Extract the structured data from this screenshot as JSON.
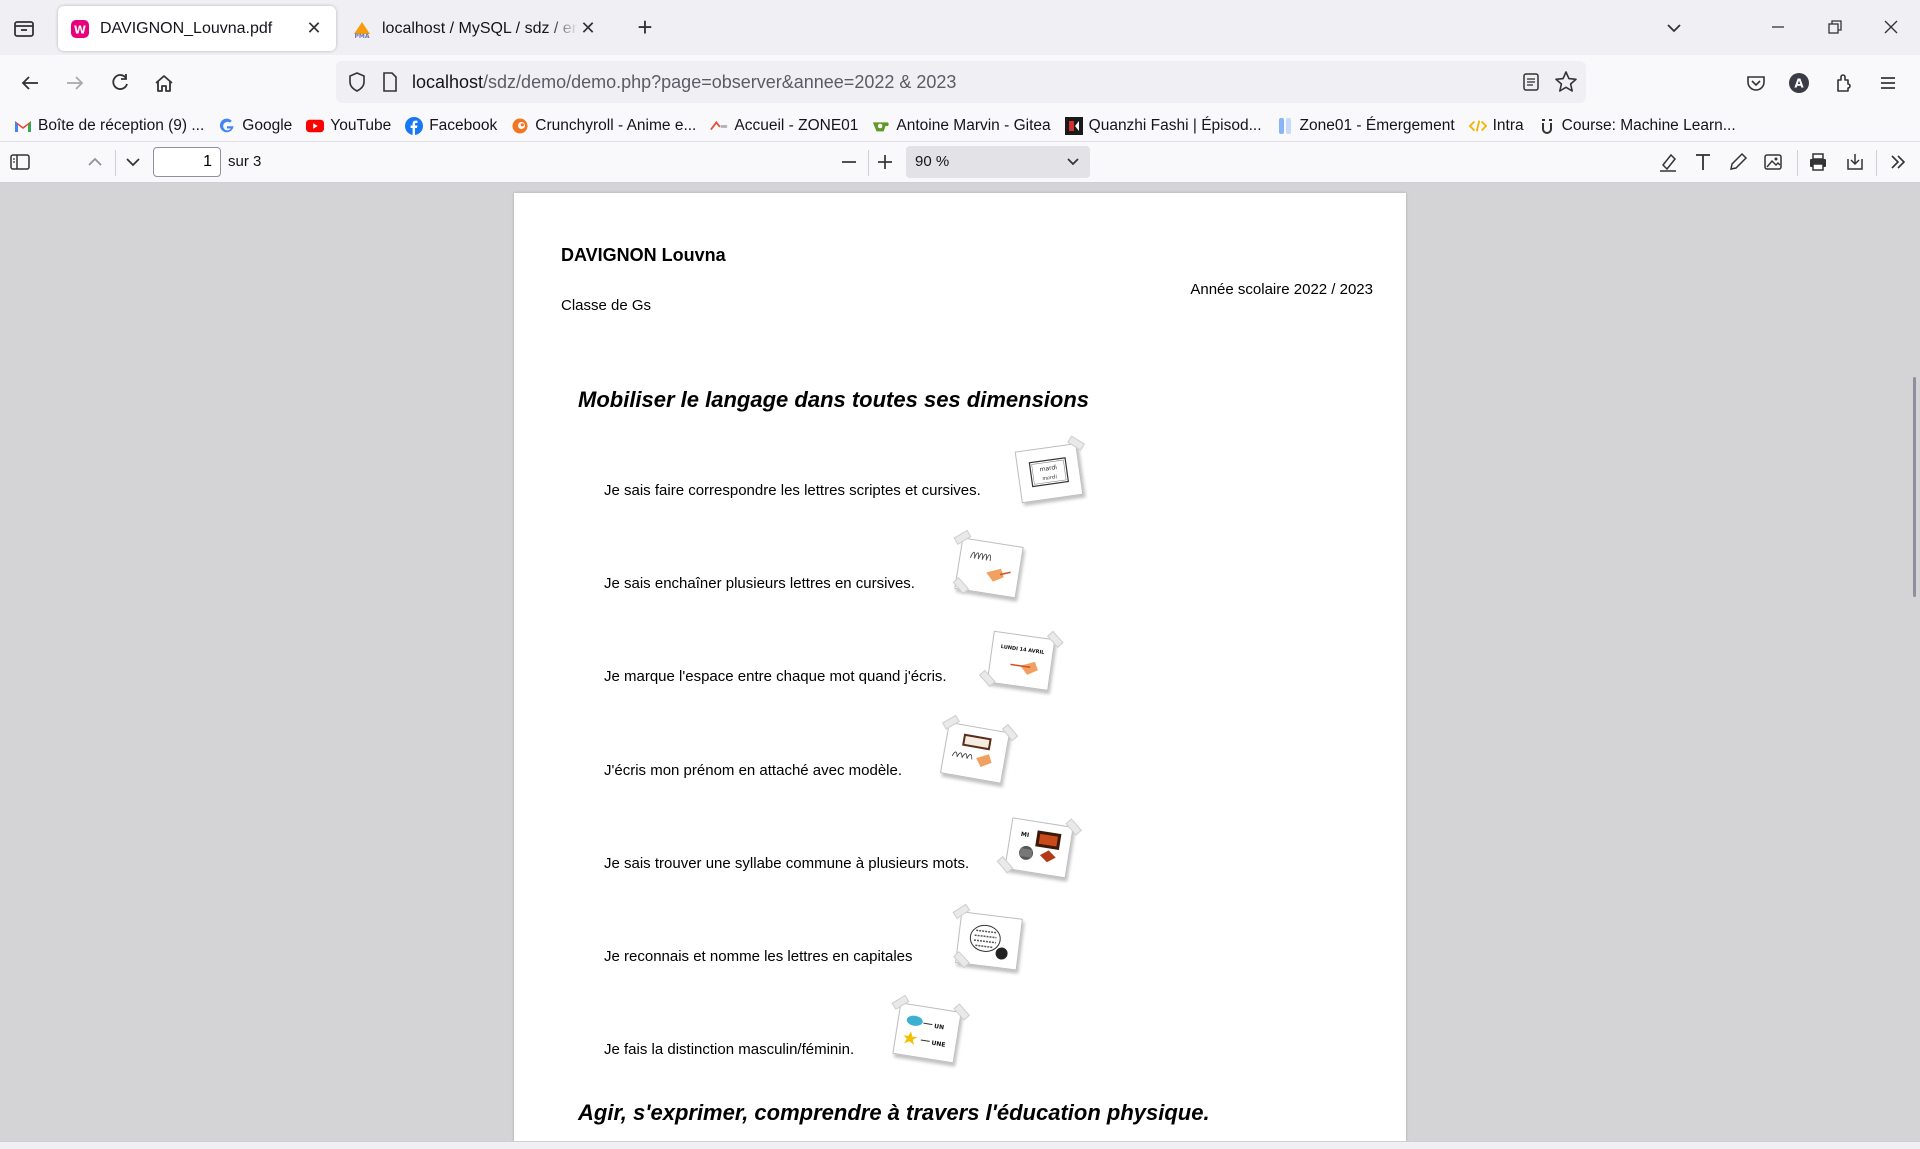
{
  "tabs": [
    {
      "title": "DAVIGNON_Louvna.pdf",
      "active": true
    },
    {
      "title": "localhost / MySQL / sdz / enseignant"
    }
  ],
  "url": {
    "host": "localhost",
    "rest": "/sdz/demo/demo.php?page=observer&annee=2022 & 2023"
  },
  "bookmarks": [
    {
      "label": "Boîte de réception (9) ...",
      "icon": "gmail-icon"
    },
    {
      "label": "Google",
      "icon": "google-icon"
    },
    {
      "label": "YouTube",
      "icon": "youtube-icon"
    },
    {
      "label": "Facebook",
      "icon": "facebook-icon"
    },
    {
      "label": "Crunchyroll - Anime e...",
      "icon": "crunchyroll-icon"
    },
    {
      "label": "Accueil - ZONE01",
      "icon": "zone01-icon"
    },
    {
      "label": "Antoine Marvin - Gitea",
      "icon": "gitea-icon"
    },
    {
      "label": "Quanzhi Fashi | Épisod...",
      "icon": "quanzhi-icon"
    },
    {
      "label": "Zone01 - Émergement",
      "icon": "zone01-emergement-icon"
    },
    {
      "label": "Intra",
      "icon": "code-icon"
    },
    {
      "label": "Course: Machine Learn...",
      "icon": "course-icon"
    }
  ],
  "pdf": {
    "page_number": "1",
    "page_total": "sur 3",
    "zoom": "90 %"
  },
  "document": {
    "student": "DAVIGNON Louvna",
    "year": "Année scolaire 2022 / 2023",
    "classe": "Classe de Gs",
    "sections": [
      {
        "title": "Mobiliser le langage dans toutes ses dimensions",
        "skills": [
          "Je sais faire correspondre les lettres scriptes et cursives.",
          "Je sais enchaîner plusieurs lettres en cursives.",
          "Je marque l'espace entre chaque mot quand j'écris.",
          "J'écris mon prénom en attaché avec modèle.",
          "Je sais trouver une syllabe commune à plusieurs mots.",
          "Je reconnais et nomme les lettres en capitales",
          "Je fais la distinction masculin/féminin."
        ]
      },
      {
        "title": "Agir, s'exprimer, comprendre à travers l'éducation physique."
      }
    ],
    "thumb_labels": {
      "mardi": "mardi",
      "lundi": "LUNDI 14 AVRIL",
      "mi": "MI",
      "un": "UN",
      "une": "UNE"
    }
  },
  "colors": {
    "tab_bar": "#f0f0f4",
    "viewer_bg": "#d4d4d7",
    "page_bg": "#ffffff"
  }
}
